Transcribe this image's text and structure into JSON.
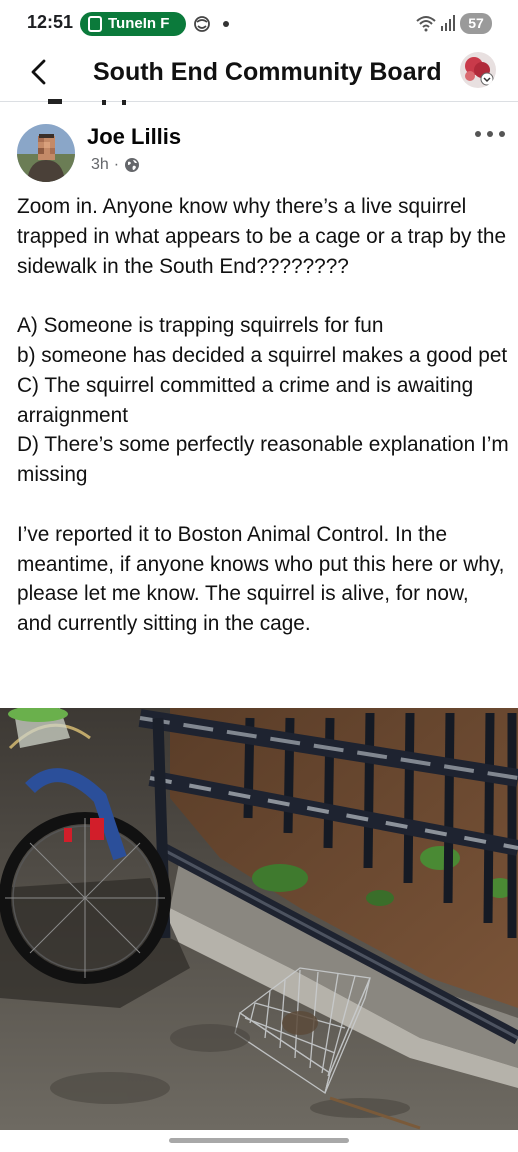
{
  "status_bar": {
    "time": "12:51",
    "app_pill": "TuneIn F",
    "battery": "57",
    "icons": [
      "tunein-icon",
      "app-notification-icon",
      "wifi-icon",
      "signal-icon",
      "battery-icon"
    ]
  },
  "header": {
    "title": "South End Community Board",
    "icons": [
      "back-arrow-icon",
      "profile-avatar"
    ]
  },
  "post": {
    "author": "Joe Lillis",
    "time": "3h",
    "separator": "·",
    "privacy_icon": "globe-icon",
    "menu_icon": "more-dots-icon",
    "paragraphs": [
      "Zoom in. Anyone know why there’s a live squirrel trapped in what appears to be a cage or a trap by the sidewalk in the South End????????",
      "",
      "A) Someone is trapping squirrels for fun",
      "b) someone has decided a squirrel makes a good pet",
      "C) The squirrel committed a crime and is awaiting arraignment",
      "D) There’s some perfectly reasonable explanation I’m missing",
      "",
      "I’ve reported it to Boston Animal Control. In the meantime, if anyone knows who put this here or why, please let me know. The squirrel is alive, for now, and currently sitting in the cage."
    ]
  },
  "colors": {
    "tunein_green": "#0b7a3b",
    "meta_grey": "#65676b",
    "divider": "#dcdfe3",
    "battery_grey": "#9a9a9a"
  }
}
